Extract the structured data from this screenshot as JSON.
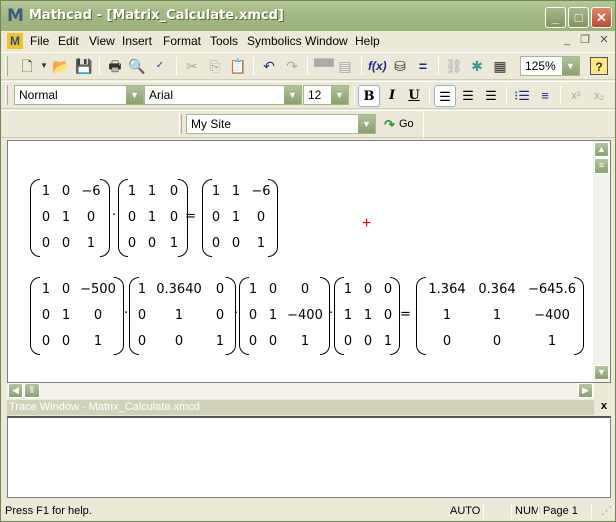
{
  "window": {
    "title": "Mathcad - [Matrix_Calculate.xmcd]",
    "app_logo": "M",
    "minimize": "_",
    "maximize": "□",
    "close": "✕"
  },
  "menu": {
    "items": [
      "File",
      "Edit",
      "View",
      "Insert",
      "Format",
      "Tools",
      "Symbolics",
      "Window",
      "Help"
    ],
    "doc_minimize": "_",
    "doc_restore": "❐",
    "doc_close": "✕"
  },
  "toolbar": {
    "icons": [
      "new-document",
      "open-folder",
      "save",
      "print",
      "print-preview",
      "spell-check",
      "cut",
      "copy",
      "paste",
      "undo",
      "redo",
      "align-across",
      "align-down",
      "insert-function",
      "insert-unit",
      "calculate",
      "component",
      "resource-center",
      "insert-table",
      "help"
    ],
    "zoom": "125%"
  },
  "format": {
    "style": "Normal",
    "font": "Arial",
    "size": "12",
    "bold": "B",
    "italic": "I",
    "underline": "U",
    "superscript": "x²",
    "subscript": "x₂"
  },
  "resources": {
    "site": "My Site",
    "go": "Go"
  },
  "worksheet": {
    "eq1": {
      "m1": [
        "1",
        "0",
        "−6",
        "0",
        "1",
        "0",
        "0",
        "0",
        "1"
      ],
      "m2": [
        "1",
        "1",
        "0",
        "0",
        "1",
        "0",
        "0",
        "0",
        "1"
      ],
      "result": [
        "1",
        "1",
        "−6",
        "0",
        "1",
        "0",
        "0",
        "0",
        "1"
      ]
    },
    "eq2": {
      "m1": [
        "1",
        "0",
        "−500",
        "0",
        "1",
        "0",
        "0",
        "0",
        "1"
      ],
      "m2": [
        "1",
        "0.3640",
        "0",
        "0",
        "1",
        "0",
        "0",
        "0",
        "1"
      ],
      "m3": [
        "1",
        "0",
        "0",
        "0",
        "1",
        "−400",
        "0",
        "0",
        "1"
      ],
      "m4": [
        "1",
        "0",
        "0",
        "1",
        "1",
        "0",
        "0",
        "0",
        "1"
      ],
      "result": [
        "1.364",
        "0.364",
        "−645.6",
        "1",
        "1",
        "−400",
        "0",
        "0",
        "1"
      ]
    },
    "dot": "·",
    "equals": "="
  },
  "trace": {
    "title": "Trace Window - Matrix_Calculate.xmcd",
    "close": "x"
  },
  "status": {
    "help": "Press F1 for help.",
    "mode": "AUTO",
    "num": "NUM",
    "page": "Page 1"
  }
}
